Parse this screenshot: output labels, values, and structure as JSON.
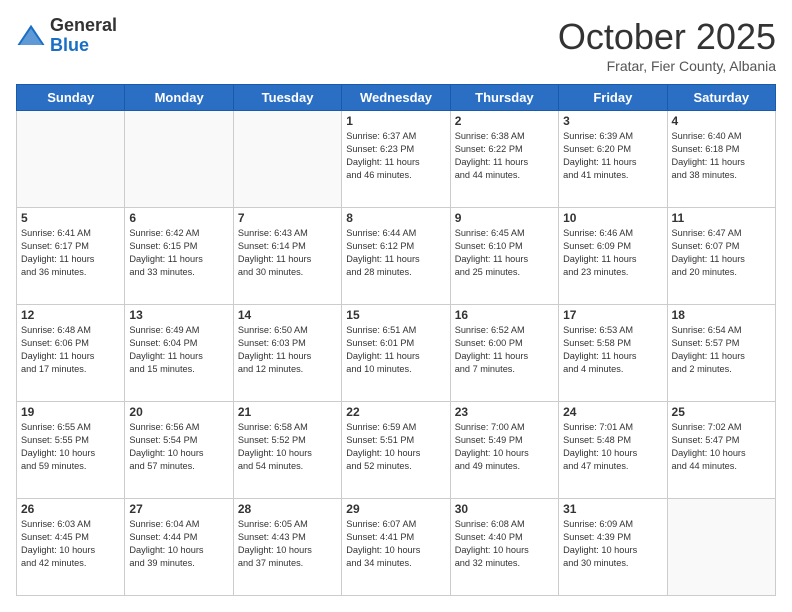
{
  "header": {
    "logo_general": "General",
    "logo_blue": "Blue",
    "month_title": "October 2025",
    "subtitle": "Fratar, Fier County, Albania"
  },
  "days_of_week": [
    "Sunday",
    "Monday",
    "Tuesday",
    "Wednesday",
    "Thursday",
    "Friday",
    "Saturday"
  ],
  "weeks": [
    [
      {
        "day": "",
        "info": ""
      },
      {
        "day": "",
        "info": ""
      },
      {
        "day": "",
        "info": ""
      },
      {
        "day": "1",
        "info": "Sunrise: 6:37 AM\nSunset: 6:23 PM\nDaylight: 11 hours\nand 46 minutes."
      },
      {
        "day": "2",
        "info": "Sunrise: 6:38 AM\nSunset: 6:22 PM\nDaylight: 11 hours\nand 44 minutes."
      },
      {
        "day": "3",
        "info": "Sunrise: 6:39 AM\nSunset: 6:20 PM\nDaylight: 11 hours\nand 41 minutes."
      },
      {
        "day": "4",
        "info": "Sunrise: 6:40 AM\nSunset: 6:18 PM\nDaylight: 11 hours\nand 38 minutes."
      }
    ],
    [
      {
        "day": "5",
        "info": "Sunrise: 6:41 AM\nSunset: 6:17 PM\nDaylight: 11 hours\nand 36 minutes."
      },
      {
        "day": "6",
        "info": "Sunrise: 6:42 AM\nSunset: 6:15 PM\nDaylight: 11 hours\nand 33 minutes."
      },
      {
        "day": "7",
        "info": "Sunrise: 6:43 AM\nSunset: 6:14 PM\nDaylight: 11 hours\nand 30 minutes."
      },
      {
        "day": "8",
        "info": "Sunrise: 6:44 AM\nSunset: 6:12 PM\nDaylight: 11 hours\nand 28 minutes."
      },
      {
        "day": "9",
        "info": "Sunrise: 6:45 AM\nSunset: 6:10 PM\nDaylight: 11 hours\nand 25 minutes."
      },
      {
        "day": "10",
        "info": "Sunrise: 6:46 AM\nSunset: 6:09 PM\nDaylight: 11 hours\nand 23 minutes."
      },
      {
        "day": "11",
        "info": "Sunrise: 6:47 AM\nSunset: 6:07 PM\nDaylight: 11 hours\nand 20 minutes."
      }
    ],
    [
      {
        "day": "12",
        "info": "Sunrise: 6:48 AM\nSunset: 6:06 PM\nDaylight: 11 hours\nand 17 minutes."
      },
      {
        "day": "13",
        "info": "Sunrise: 6:49 AM\nSunset: 6:04 PM\nDaylight: 11 hours\nand 15 minutes."
      },
      {
        "day": "14",
        "info": "Sunrise: 6:50 AM\nSunset: 6:03 PM\nDaylight: 11 hours\nand 12 minutes."
      },
      {
        "day": "15",
        "info": "Sunrise: 6:51 AM\nSunset: 6:01 PM\nDaylight: 11 hours\nand 10 minutes."
      },
      {
        "day": "16",
        "info": "Sunrise: 6:52 AM\nSunset: 6:00 PM\nDaylight: 11 hours\nand 7 minutes."
      },
      {
        "day": "17",
        "info": "Sunrise: 6:53 AM\nSunset: 5:58 PM\nDaylight: 11 hours\nand 4 minutes."
      },
      {
        "day": "18",
        "info": "Sunrise: 6:54 AM\nSunset: 5:57 PM\nDaylight: 11 hours\nand 2 minutes."
      }
    ],
    [
      {
        "day": "19",
        "info": "Sunrise: 6:55 AM\nSunset: 5:55 PM\nDaylight: 10 hours\nand 59 minutes."
      },
      {
        "day": "20",
        "info": "Sunrise: 6:56 AM\nSunset: 5:54 PM\nDaylight: 10 hours\nand 57 minutes."
      },
      {
        "day": "21",
        "info": "Sunrise: 6:58 AM\nSunset: 5:52 PM\nDaylight: 10 hours\nand 54 minutes."
      },
      {
        "day": "22",
        "info": "Sunrise: 6:59 AM\nSunset: 5:51 PM\nDaylight: 10 hours\nand 52 minutes."
      },
      {
        "day": "23",
        "info": "Sunrise: 7:00 AM\nSunset: 5:49 PM\nDaylight: 10 hours\nand 49 minutes."
      },
      {
        "day": "24",
        "info": "Sunrise: 7:01 AM\nSunset: 5:48 PM\nDaylight: 10 hours\nand 47 minutes."
      },
      {
        "day": "25",
        "info": "Sunrise: 7:02 AM\nSunset: 5:47 PM\nDaylight: 10 hours\nand 44 minutes."
      }
    ],
    [
      {
        "day": "26",
        "info": "Sunrise: 6:03 AM\nSunset: 4:45 PM\nDaylight: 10 hours\nand 42 minutes."
      },
      {
        "day": "27",
        "info": "Sunrise: 6:04 AM\nSunset: 4:44 PM\nDaylight: 10 hours\nand 39 minutes."
      },
      {
        "day": "28",
        "info": "Sunrise: 6:05 AM\nSunset: 4:43 PM\nDaylight: 10 hours\nand 37 minutes."
      },
      {
        "day": "29",
        "info": "Sunrise: 6:07 AM\nSunset: 4:41 PM\nDaylight: 10 hours\nand 34 minutes."
      },
      {
        "day": "30",
        "info": "Sunrise: 6:08 AM\nSunset: 4:40 PM\nDaylight: 10 hours\nand 32 minutes."
      },
      {
        "day": "31",
        "info": "Sunrise: 6:09 AM\nSunset: 4:39 PM\nDaylight: 10 hours\nand 30 minutes."
      },
      {
        "day": "",
        "info": ""
      }
    ]
  ]
}
